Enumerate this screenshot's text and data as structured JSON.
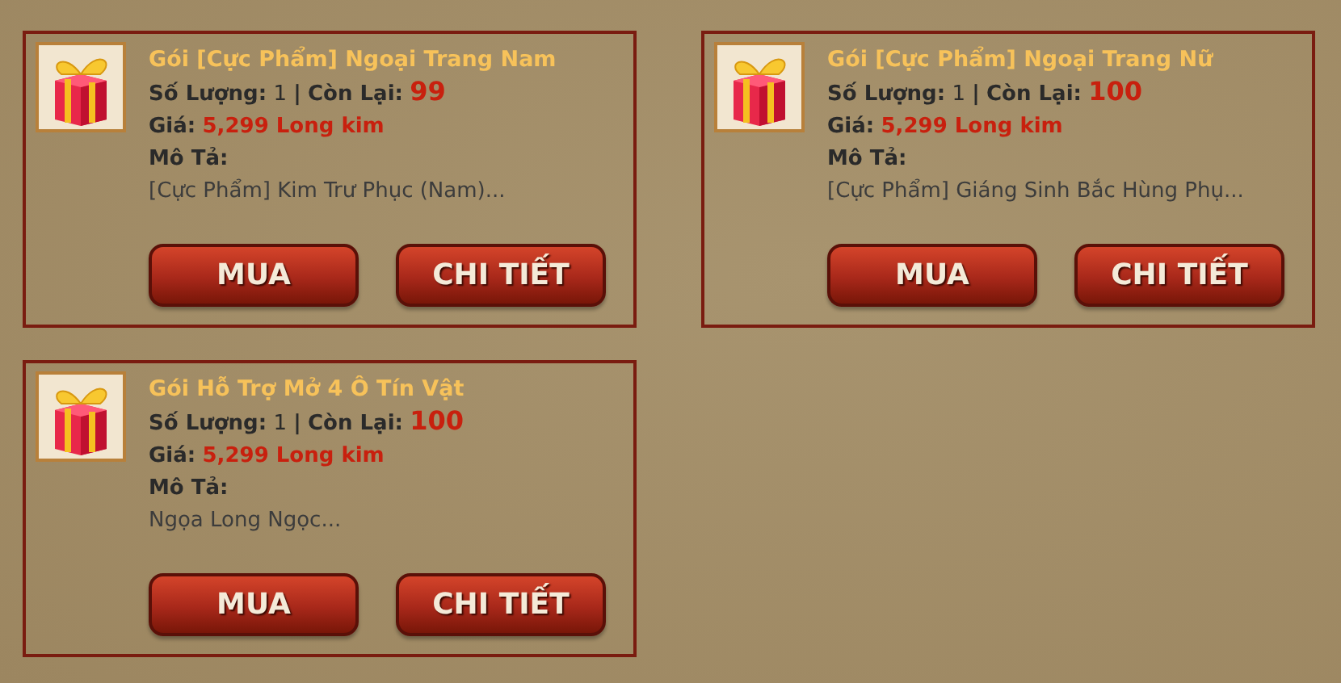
{
  "packages": [
    {
      "title": "Gói [Cực Phẩm] Ngoại Trang Nam",
      "quantity_label": "Số Lượng:",
      "quantity": "1",
      "separator": "|",
      "remaining_label": "Còn Lại:",
      "remaining": "99",
      "price_label": "Giá:",
      "price": "5,299 Long kim",
      "description_label": "Mô Tả:",
      "description": "[Cực Phẩm] Kim Trư Phục (Nam)...",
      "buttons": [
        "MUA",
        "CHI TIẾT"
      ]
    },
    {
      "title": "Gói [Cực Phẩm] Ngoại Trang Nữ",
      "quantity_label": "Số Lượng:",
      "quantity": "1",
      "separator": "|",
      "remaining_label": "Còn Lại:",
      "remaining": "100",
      "price_label": "Giá:",
      "price": "5,299 Long kim",
      "description_label": "Mô Tả:",
      "description": "[Cực Phẩm] Giáng Sinh Bắc Hùng Phụ...",
      "buttons": [
        "MUA",
        "CHI TIẾT"
      ]
    },
    {
      "title": "Gói Hỗ Trợ Mở 4 Ô Tín Vật",
      "quantity_label": "Số Lượng:",
      "quantity": "1",
      "separator": "|",
      "remaining_label": "Còn Lại:",
      "remaining": "100",
      "price_label": "Giá:",
      "price": "5,299 Long kim",
      "description_label": "Mô Tả:",
      "description": "Ngọa Long Ngọc...",
      "buttons": [
        "MUA",
        "CHI TIẾT"
      ]
    }
  ]
}
